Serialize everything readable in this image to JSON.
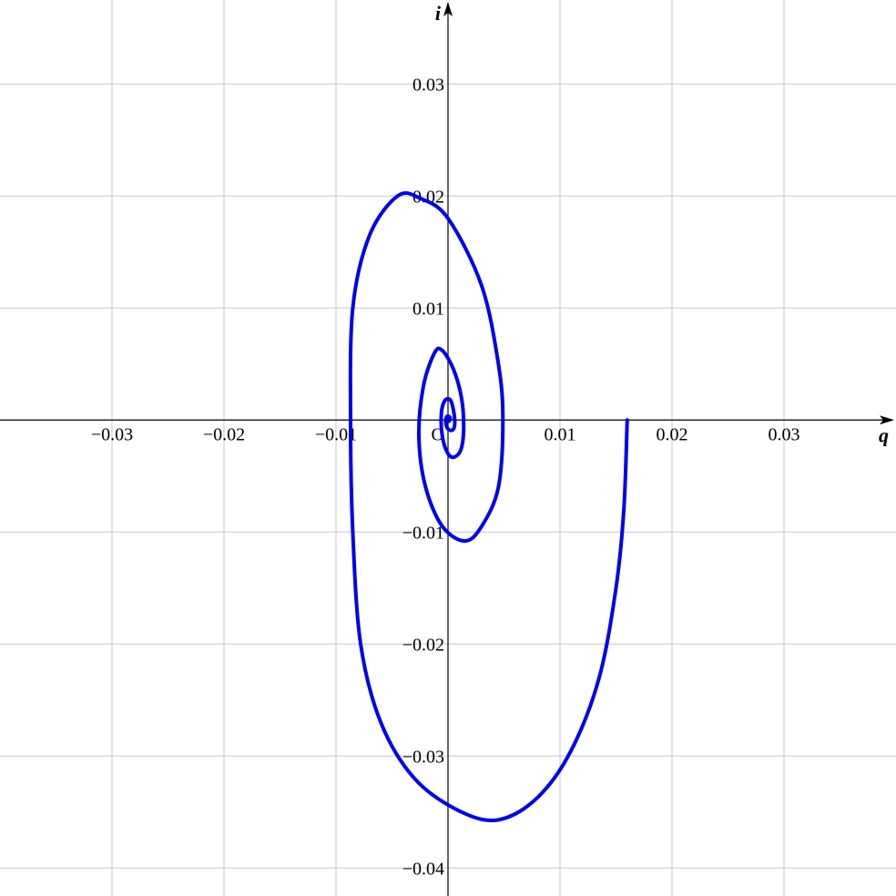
{
  "chart_data": {
    "type": "line",
    "title": "",
    "xlabel": "q",
    "ylabel": "i",
    "origin_label": "O",
    "xlim": [
      -0.04,
      0.04
    ],
    "ylim": [
      -0.0425,
      0.0375
    ],
    "grid": true,
    "legend": "none",
    "colors": {
      "curve": "#0000ee",
      "grid": "#c4c4e0",
      "axis": "#000000"
    },
    "x_ticks": [
      {
        "value": -0.03,
        "label": "−0.03"
      },
      {
        "value": -0.02,
        "label": "−0.02"
      },
      {
        "value": -0.01,
        "label": "−0.01"
      },
      {
        "value": 0.01,
        "label": "0.01"
      },
      {
        "value": 0.02,
        "label": "0.02"
      },
      {
        "value": 0.03,
        "label": "0.03"
      }
    ],
    "y_ticks": [
      {
        "value": 0.03,
        "label": "0.03"
      },
      {
        "value": 0.02,
        "label": "0.02"
      },
      {
        "value": 0.01,
        "label": "0.01"
      },
      {
        "value": -0.01,
        "label": "−0.01"
      },
      {
        "value": -0.02,
        "label": "−0.02"
      },
      {
        "value": -0.03,
        "label": "−0.03"
      },
      {
        "value": -0.04,
        "label": "−0.04"
      }
    ],
    "series": [
      {
        "points": [
          [
            0.016,
            0.0
          ],
          [
            0.0157,
            -0.008
          ],
          [
            0.015,
            -0.015
          ],
          [
            0.0135,
            -0.023
          ],
          [
            0.011,
            -0.0295
          ],
          [
            0.008,
            -0.0337
          ],
          [
            0.0045,
            -0.0357
          ],
          [
            0.001,
            -0.0349
          ],
          [
            -0.003,
            -0.032
          ],
          [
            -0.006,
            -0.027
          ],
          [
            -0.0078,
            -0.02
          ],
          [
            -0.0085,
            -0.01
          ],
          [
            -0.0087,
            0.0
          ],
          [
            -0.0085,
            0.01
          ],
          [
            -0.007,
            0.0165
          ],
          [
            -0.0045,
            0.02
          ],
          [
            -0.0025,
            0.0198
          ],
          [
            0.0,
            0.018
          ],
          [
            0.003,
            0.012
          ],
          [
            0.0045,
            0.005
          ],
          [
            0.0049,
            0.0
          ],
          [
            0.0045,
            -0.006
          ],
          [
            0.003,
            -0.0095
          ],
          [
            0.0015,
            -0.0108
          ],
          [
            -0.0005,
            -0.0095
          ],
          [
            -0.002,
            -0.006
          ],
          [
            -0.0026,
            -0.0015
          ],
          [
            -0.0022,
            0.003
          ],
          [
            -0.0012,
            0.006
          ],
          [
            -0.0005,
            0.0062
          ],
          [
            0.0005,
            0.0045
          ],
          [
            0.0012,
            0.002
          ],
          [
            0.0014,
            -0.0005
          ],
          [
            0.0012,
            -0.0025
          ],
          [
            0.0006,
            -0.0033
          ],
          [
            0.0,
            -0.003
          ],
          [
            -0.0005,
            -0.0015
          ],
          [
            -0.0006,
            0.0005
          ],
          [
            -0.0003,
            0.0017
          ],
          [
            0.0002,
            0.0018
          ],
          [
            0.0005,
            0.0008
          ],
          [
            0.0006,
            -0.0004
          ],
          [
            0.0004,
            -0.0009
          ],
          [
            0.0,
            -0.0008
          ],
          [
            -0.0002,
            -0.0002
          ],
          [
            -0.0001,
            0.0003
          ],
          [
            0.0001,
            0.0003
          ],
          [
            0.0002,
            0.0001
          ],
          [
            0.0001,
            -0.0001
          ]
        ]
      }
    ]
  }
}
